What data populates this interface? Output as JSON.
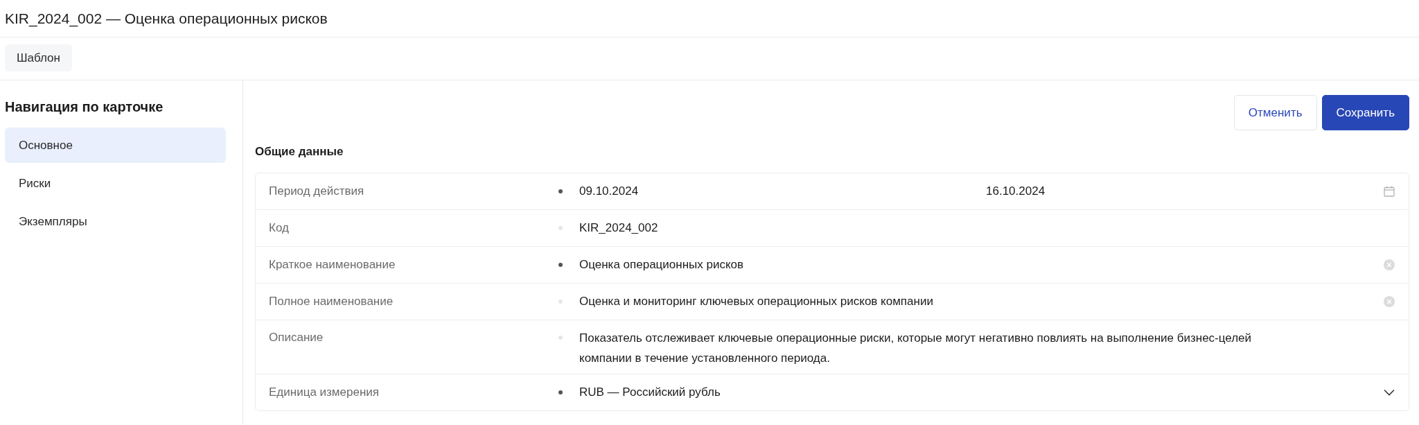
{
  "header": {
    "title": "KIR_2024_002 — Оценка операционных рисков"
  },
  "toolbar": {
    "buttons": [
      "Шаблон"
    ]
  },
  "sidebar": {
    "title": "Навигация по карточке",
    "items": [
      {
        "label": "Основное",
        "selected": true
      },
      {
        "label": "Риски",
        "selected": false
      },
      {
        "label": "Экземпляры",
        "selected": false
      }
    ]
  },
  "actions": [
    {
      "label": "Отменить",
      "kind": "secondary"
    },
    {
      "label": "Сохранить",
      "kind": "primary"
    }
  ],
  "section": {
    "title": "Общие данные",
    "fields": [
      {
        "label": "Период действия",
        "required": true,
        "kind": "date_range",
        "values": [
          "09.10.2024",
          "16.10.2024"
        ]
      },
      {
        "label": "Код",
        "required": false,
        "kind": "text",
        "value": "KIR_2024_002"
      },
      {
        "label": "Краткое наименование",
        "required": true,
        "kind": "clearable",
        "value": "Оценка операционных рисков"
      },
      {
        "label": "Полное наименование",
        "required": false,
        "kind": "clearable",
        "value": "Оценка и мониторинг ключевых операционных рисков компании"
      },
      {
        "label": "Описание",
        "required": false,
        "kind": "textarea",
        "value": "Показатель отслеживает ключевые операционные риски, которые могут негативно повлиять на выполнение бизнес-целей компании в течение установленного периода."
      },
      {
        "label": "Единица измерения",
        "required": true,
        "kind": "select",
        "value": "RUB — Российский рубль"
      }
    ]
  }
}
